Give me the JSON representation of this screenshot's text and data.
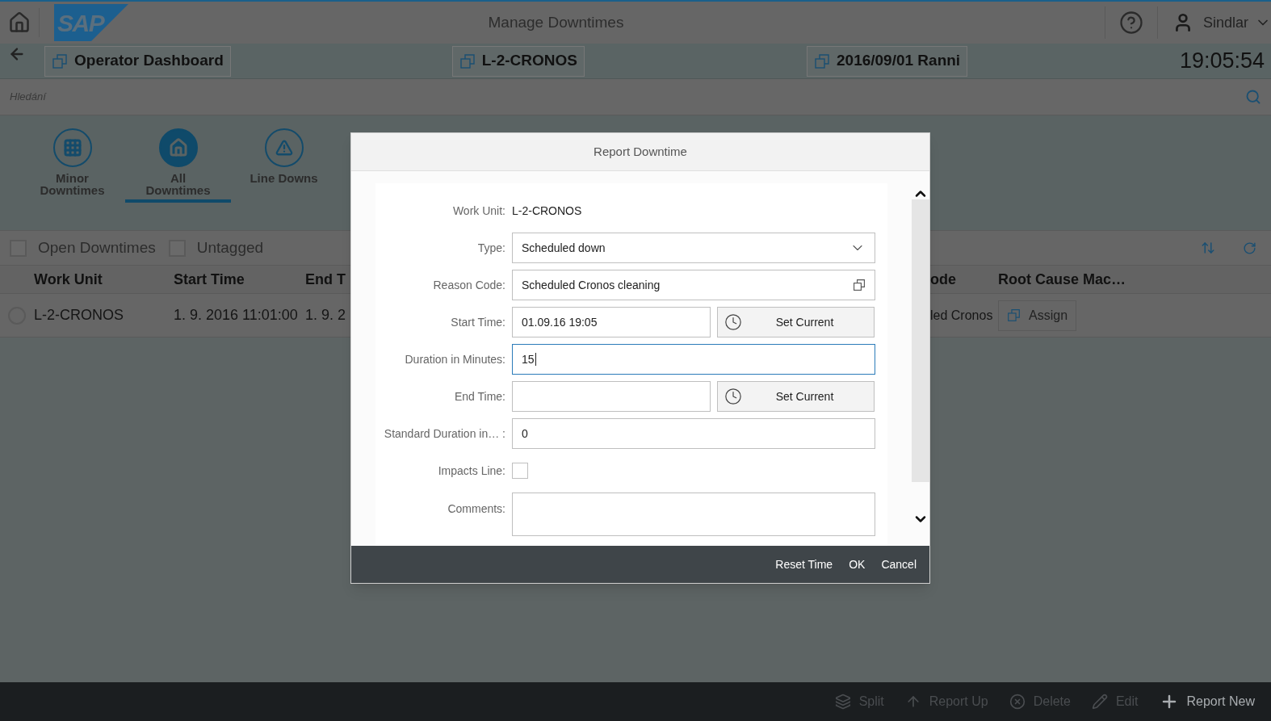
{
  "header": {
    "logo": "SAP",
    "title": "Manage Downtimes",
    "user": "Sindlar"
  },
  "context_bar": {
    "buttons": [
      "Operator Dashboard",
      "L-2-CRONOS",
      "2016/09/01 Ranni"
    ],
    "clock": "19:05:54"
  },
  "search": {
    "placeholder": "Hledání"
  },
  "tabs": [
    {
      "label": "Minor Downtimes",
      "kind": "minor",
      "selected": false
    },
    {
      "label": "All Downtimes",
      "kind": "all",
      "selected": true
    },
    {
      "label": "Line Downs",
      "kind": "line",
      "selected": false
    }
  ],
  "filters": [
    {
      "label": "Open Downtimes",
      "checked": false
    },
    {
      "label": "Untagged",
      "checked": false
    }
  ],
  "table": {
    "columns": [
      "Work Unit",
      "Start Time",
      "End T",
      "ode",
      "Root Cause Mac…"
    ],
    "rows": [
      {
        "selected": false,
        "cells": [
          "L-2-CRONOS",
          "1. 9. 2016 11:01:00",
          "1. 9. 2",
          "led Cronos"
        ],
        "action": "Assign"
      }
    ]
  },
  "toolbar": [
    {
      "label": "Split",
      "kind": "split",
      "disabled": true
    },
    {
      "label": "Report Up",
      "kind": "up",
      "disabled": true
    },
    {
      "label": "Delete",
      "kind": "delete",
      "disabled": true
    },
    {
      "label": "Edit",
      "kind": "edit",
      "disabled": true
    },
    {
      "label": "Report New",
      "kind": "new",
      "disabled": false
    }
  ],
  "dialog": {
    "title": "Report Downtime",
    "fields": [
      {
        "label": "Work Unit:",
        "kind": "text",
        "value": "L-2-CRONOS"
      },
      {
        "label": "Type:",
        "kind": "select",
        "value": "Scheduled down"
      },
      {
        "label": "Reason Code:",
        "kind": "value_help",
        "value": "Scheduled Cronos cleaning"
      },
      {
        "label": "Start Time:",
        "kind": "time",
        "value": "01.09.16 19:05",
        "button": "Set Current"
      },
      {
        "label": "Duration in Minutes:",
        "kind": "input",
        "value": "15",
        "focused": true
      },
      {
        "label": "End Time:",
        "kind": "time",
        "button": "Set Current"
      },
      {
        "label": "Standard Duration in… :",
        "kind": "input",
        "value": "0",
        "focused": false
      },
      {
        "label": "Impacts Line:",
        "kind": "checkbox",
        "checked": false
      },
      {
        "label": "Comments:",
        "kind": "textarea"
      }
    ],
    "buttons": [
      "Reset Time",
      "OK",
      "Cancel"
    ]
  }
}
